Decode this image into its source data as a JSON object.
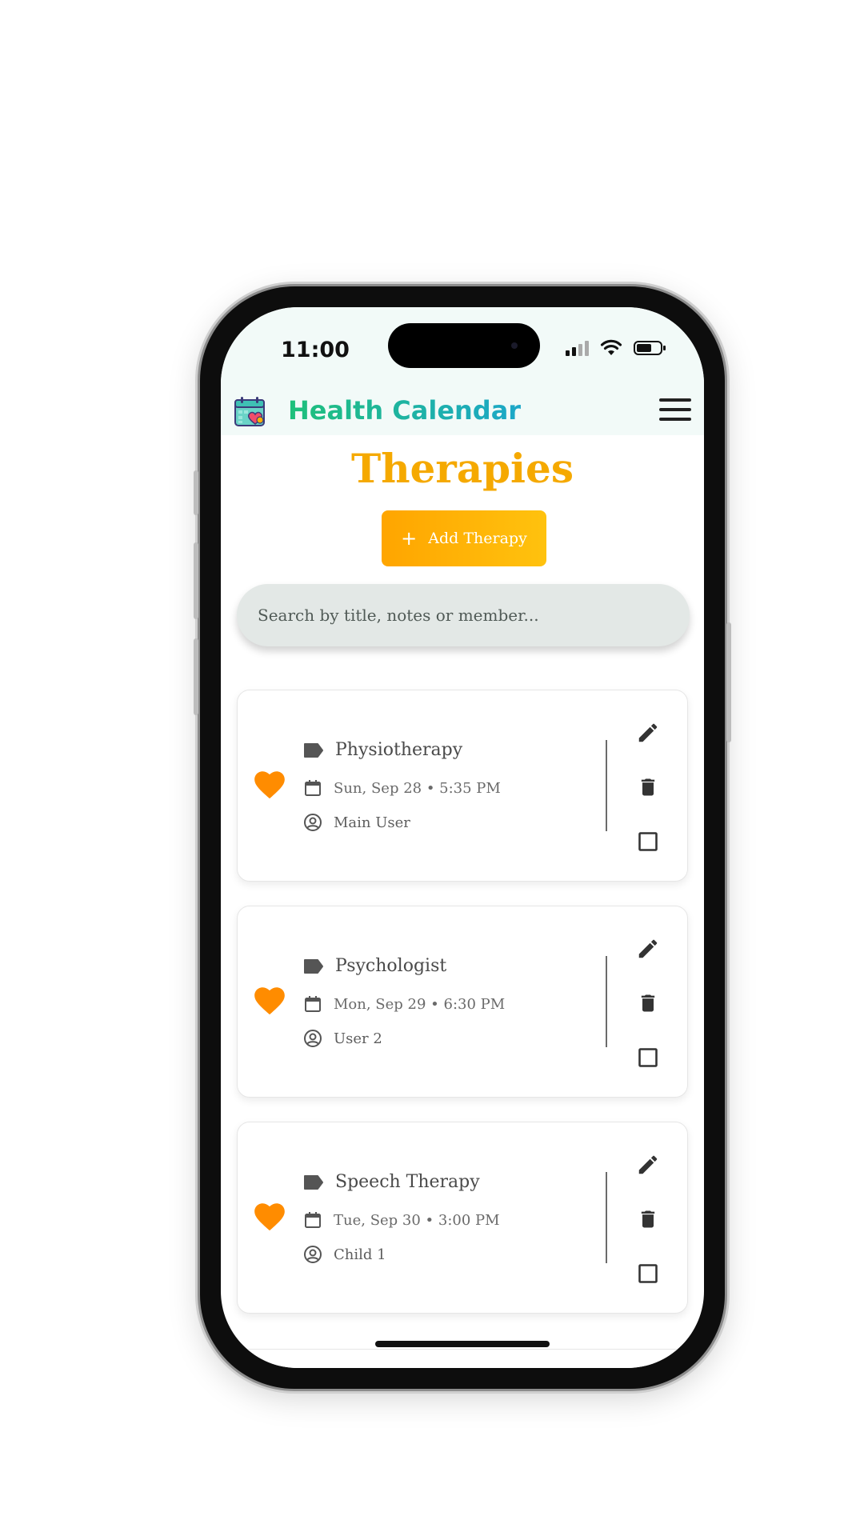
{
  "status_bar": {
    "time": "11:00"
  },
  "header": {
    "app_title": "Health Calendar"
  },
  "page": {
    "title": "Therapies",
    "add_button": "Add Therapy"
  },
  "search": {
    "placeholder": "Search by title, notes or member..."
  },
  "colors": {
    "accent": "#f5a900",
    "heart": "#ff8c00",
    "title_gradient_start": "#1ec07a",
    "title_gradient_end": "#1da7c9"
  },
  "therapies": [
    {
      "title": "Physiotherapy",
      "datetime": "Sun, Sep 28 • 5:35 PM",
      "member": "Main User"
    },
    {
      "title": "Psychologist",
      "datetime": "Mon, Sep 29 • 6:30 PM",
      "member": "User 2"
    },
    {
      "title": "Speech Therapy",
      "datetime": "Tue, Sep 30 • 3:00 PM",
      "member": "Child 1"
    }
  ]
}
